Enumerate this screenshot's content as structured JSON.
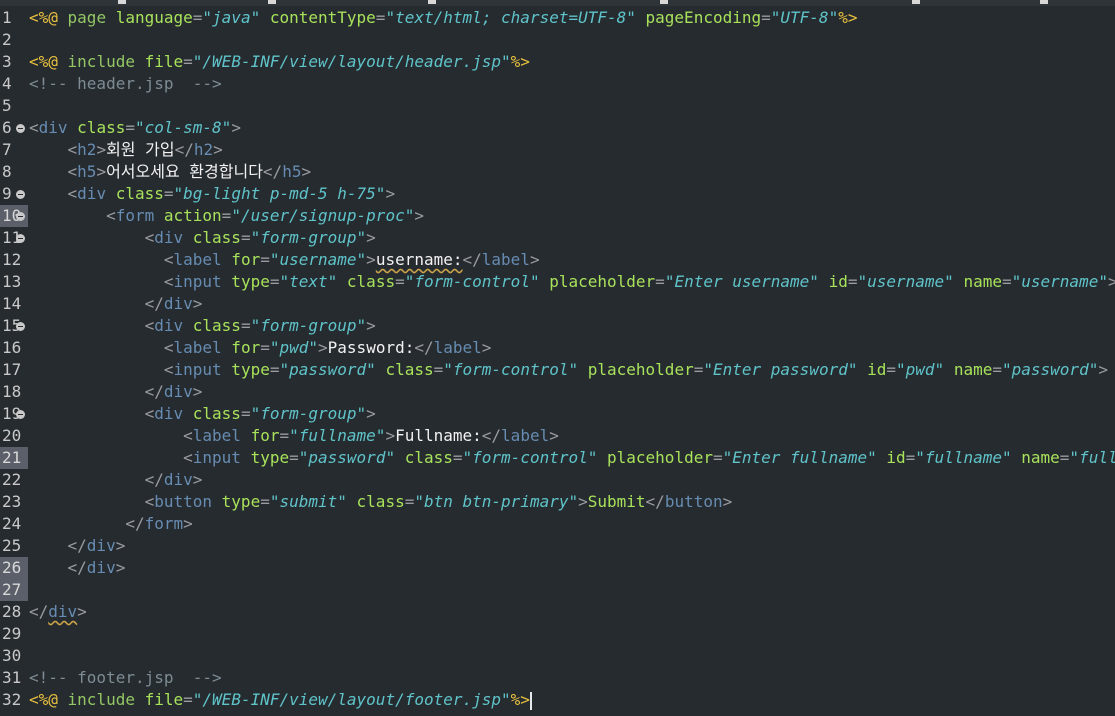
{
  "editor": {
    "language": "JSP",
    "colors": {
      "background": "#262b30",
      "jsp_keyword": "#93c763",
      "jsp_delimiter": "#e8c13f",
      "tag": "#678cb1",
      "attribute": "#a8e25a",
      "string": "#5fc4c9",
      "text": "#f2f2f2",
      "comment": "#7d8c93"
    },
    "line_numbers": [
      "1",
      "2",
      "3",
      "4",
      "5",
      "6",
      "7",
      "8",
      "9",
      "10",
      "11",
      "12",
      "13",
      "14",
      "15",
      "16",
      "17",
      "18",
      "19",
      "20",
      "21",
      "22",
      "23",
      "24",
      "25",
      "26",
      "27",
      "28",
      "29",
      "30",
      "31",
      "32"
    ],
    "highlighted_lines": [
      "10",
      "21",
      "26",
      "27"
    ],
    "folding_lines": [
      "6",
      "9",
      "10",
      "11",
      "15",
      "19"
    ],
    "tokens": {
      "l1": [
        "<%@",
        " page ",
        "language",
        "=",
        "\"java\"",
        " contentType",
        "=",
        "\"text/html; charset=UTF-8\"",
        " pageEncoding",
        "=",
        "\"UTF-8\"",
        "%>"
      ],
      "l3": [
        "<%@",
        " include ",
        "file",
        "=",
        "\"/WEB-INF/view/layout/header.jsp\"",
        "%>"
      ],
      "l4": [
        "<!-- header.jsp  -->"
      ],
      "l6": [
        "<",
        "div",
        " class",
        "=",
        "\"col-sm-8\"",
        ">"
      ],
      "l7": [
        "    ",
        "<",
        "h2",
        ">",
        "회원 가입",
        "</",
        "h2",
        ">"
      ],
      "l8": [
        "    ",
        "<",
        "h5",
        ">",
        "어서오세요 환경합니다",
        "</",
        "h5",
        ">"
      ],
      "l9": [
        "    ",
        "<",
        "div",
        " class",
        "=",
        "\"bg-light p-md-5 h-75\"",
        ">"
      ],
      "l10": [
        "        ",
        "<",
        "form",
        " action",
        "=",
        "\"/user/signup-proc\"",
        ">"
      ],
      "l11": [
        "            ",
        "<",
        "div",
        " class",
        "=",
        "\"form-group\"",
        ">"
      ],
      "l12": [
        "              ",
        "<",
        "label",
        " for",
        "=",
        "\"username\"",
        ">",
        "username:",
        "</",
        "label",
        ">"
      ],
      "l13": [
        "              ",
        "<",
        "input",
        " type",
        "=",
        "\"text\"",
        " class",
        "=",
        "\"form-control\"",
        " placeholder",
        "=",
        "\"Enter username\"",
        " id",
        "=",
        "\"username\"",
        " name",
        "=",
        "\"username\"",
        ">"
      ],
      "l14": [
        "            ",
        "</",
        "div",
        ">"
      ],
      "l15": [
        "            ",
        "<",
        "div",
        " class",
        "=",
        "\"form-group\"",
        ">"
      ],
      "l16": [
        "              ",
        "<",
        "label",
        " for",
        "=",
        "\"pwd\"",
        ">",
        "Password:",
        "</",
        "label",
        ">"
      ],
      "l17": [
        "              ",
        "<",
        "input",
        " type",
        "=",
        "\"password\"",
        " class",
        "=",
        "\"form-control\"",
        " placeholder",
        "=",
        "\"Enter password\"",
        " id",
        "=",
        "\"pwd\"",
        " name",
        "=",
        "\"password\"",
        ">"
      ],
      "l18": [
        "            ",
        "</",
        "div",
        ">"
      ],
      "l19": [
        "            ",
        "<",
        "div",
        " class",
        "=",
        "\"form-group\"",
        ">"
      ],
      "l20": [
        "                ",
        "<",
        "label",
        " for",
        "=",
        "\"fullname\"",
        ">",
        "Fullname:",
        "</",
        "label",
        ">"
      ],
      "l21": [
        "                ",
        "<",
        "input",
        " type",
        "=",
        "\"password\"",
        " class",
        "=",
        "\"form-control\"",
        " placeholder",
        "=",
        "\"Enter fullname\"",
        " id",
        "=",
        "\"fullname\"",
        " name",
        "=",
        "\"fullname\"",
        ">"
      ],
      "l22": [
        "            ",
        "</",
        "div",
        ">"
      ],
      "l23": [
        "            ",
        "<",
        "button",
        " type",
        "=",
        "\"submit\"",
        " class",
        "=",
        "\"btn btn-primary\"",
        ">",
        "Submit",
        "</",
        "button",
        ">"
      ],
      "l24": [
        "          ",
        "</",
        "form",
        ">"
      ],
      "l25": [
        "    ",
        "</",
        "div",
        ">"
      ],
      "l26": [
        "    ",
        "</",
        "div",
        ">"
      ],
      "l28": [
        "</",
        "div",
        ">"
      ],
      "l31": [
        "<!-- footer.jsp  -->"
      ],
      "l32": [
        "<%@",
        " include ",
        "file",
        "=",
        "\"/WEB-INF/view/layout/footer.jsp\"",
        "%>"
      ]
    }
  }
}
